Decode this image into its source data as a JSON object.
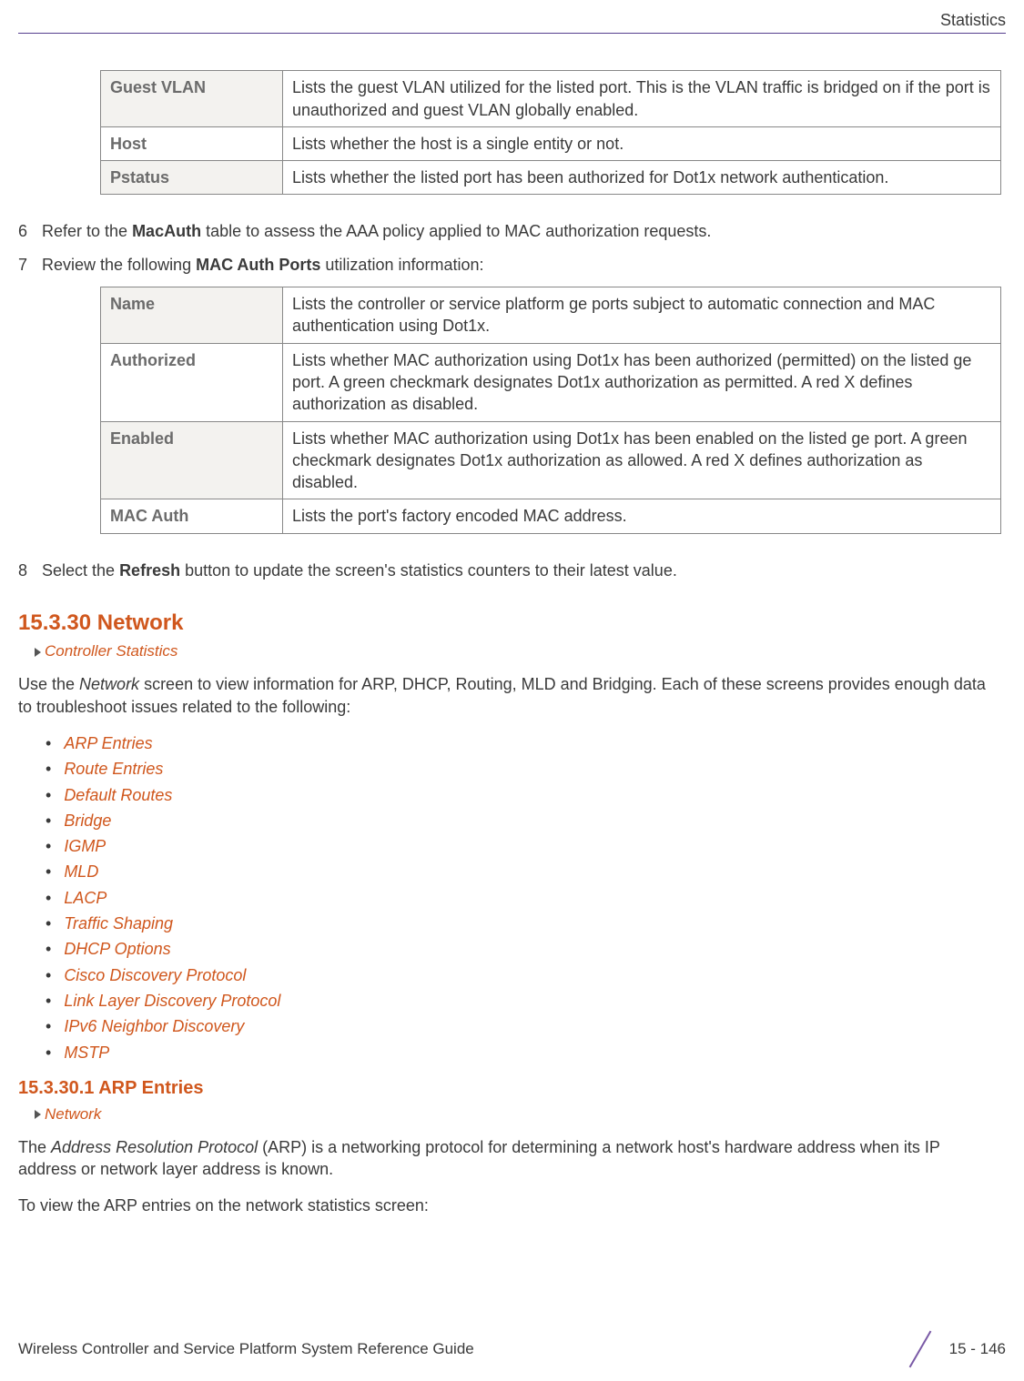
{
  "header": {
    "section": "Statistics"
  },
  "table1": {
    "rows": [
      {
        "label": "Guest VLAN",
        "desc": "Lists the guest VLAN utilized for the listed port. This is the VLAN traffic is bridged on if the port is unauthorized and guest VLAN globally enabled."
      },
      {
        "label": "Host",
        "desc": "Lists whether the host is a single entity or not."
      },
      {
        "label": "Pstatus",
        "desc": "Lists whether the listed port has been authorized for Dot1x network authentication."
      }
    ]
  },
  "steps": {
    "s6": {
      "num": "6",
      "pre": "Refer to the ",
      "bold": "MacAuth",
      "post": " table to assess the AAA policy applied to MAC authorization requests."
    },
    "s7": {
      "num": "7",
      "pre": "Review the following ",
      "bold": "MAC Auth Ports",
      "post": " utilization information:"
    },
    "s8": {
      "num": "8",
      "pre": "Select the ",
      "bold": "Refresh",
      "post": " button to update the screen's statistics counters to their latest value."
    }
  },
  "table2": {
    "rows": [
      {
        "label": "Name",
        "desc": "Lists the controller or service platform ge ports subject to automatic connection and MAC authentication using Dot1x."
      },
      {
        "label": "Authorized",
        "desc": "Lists whether MAC authorization using Dot1x has been authorized (permitted) on the listed ge port. A green checkmark designates Dot1x authorization as permitted. A red X defines authorization as disabled."
      },
      {
        "label": "Enabled",
        "desc": "Lists whether MAC authorization using Dot1x has been enabled on the listed ge port. A green checkmark designates Dot1x authorization as allowed. A red X defines authorization as disabled."
      },
      {
        "label": "MAC Auth",
        "desc": "Lists the port's factory encoded MAC address."
      }
    ]
  },
  "section": {
    "heading": "15.3.30 Network",
    "breadcrumb": "Controller Statistics",
    "para_pre": "Use the ",
    "para_ital": "Network",
    "para_post": " screen to view information for ARP, DHCP, Routing, MLD and Bridging. Each of these screens provides enough data to troubleshoot issues related to the following:"
  },
  "links": [
    "ARP Entries",
    "Route Entries",
    "Default Routes",
    "Bridge",
    "IGMP",
    "MLD",
    "LACP",
    "Traffic Shaping",
    "DHCP Options",
    "Cisco Discovery Protocol",
    "Link Layer Discovery Protocol",
    "IPv6 Neighbor Discovery",
    "MSTP"
  ],
  "subsection": {
    "heading": "15.3.30.1  ARP Entries",
    "breadcrumb": "Network",
    "para_pre": "The ",
    "para_ital": "Address Resolution Protocol",
    "para_post": " (ARP) is a networking protocol for determining a network host's hardware address when its IP address or network layer address is known.",
    "para2": "To view the ARP entries on the network statistics screen:"
  },
  "footer": {
    "left": "Wireless Controller and Service Platform System Reference Guide",
    "right": "15 - 146"
  }
}
